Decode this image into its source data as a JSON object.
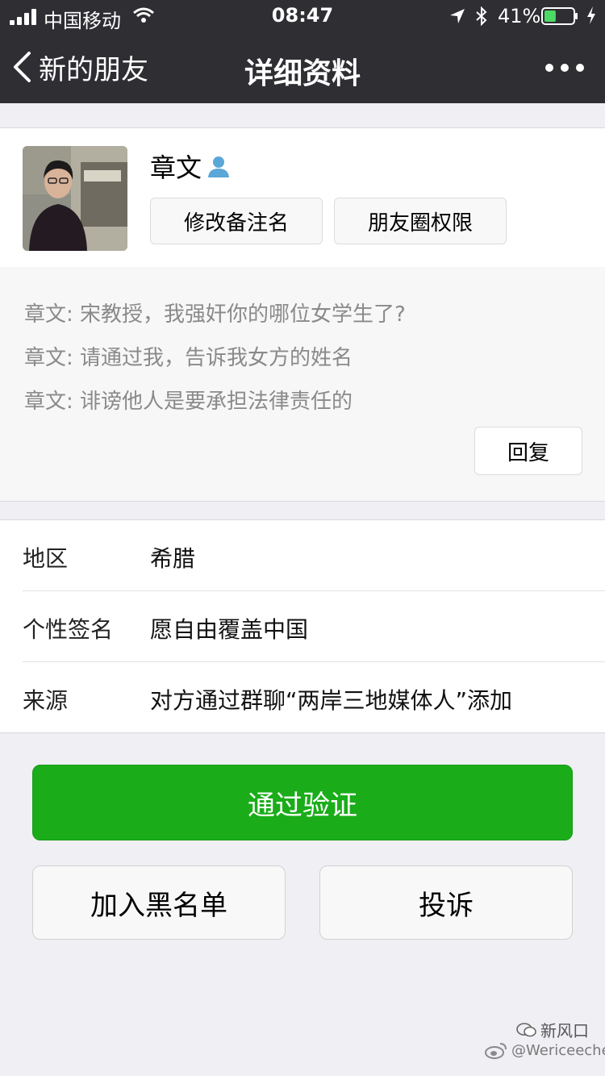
{
  "status_bar": {
    "carrier": "中国移动",
    "time": "08:47",
    "battery_percent": "41%",
    "battery_level": 0.41,
    "battery_color": "#4cd964"
  },
  "nav": {
    "back_label": "新的朋友",
    "title": "详细资料",
    "more_icon": "more-dots-icon"
  },
  "profile": {
    "name": "章文",
    "badge_icon": "person-icon",
    "remark_button": "修改备注名",
    "moments_button": "朋友圈权限"
  },
  "messages": [
    "章文: 宋教授，我强奸你的哪位女学生了?",
    "章文: 请通过我，告诉我女方的姓名",
    "章文: 诽谤他人是要承担法律责任的"
  ],
  "reply_button": "回复",
  "info": [
    {
      "label": "地区",
      "value": "希腊"
    },
    {
      "label": "个性签名",
      "value": "愿自由覆盖中国"
    },
    {
      "label": "来源",
      "value": "对方通过群聊“两岸三地媒体人”添加"
    }
  ],
  "actions": {
    "accept": "通过验证",
    "blacklist": "加入黑名单",
    "report": "投诉",
    "accept_color": "#1aad19"
  },
  "watermark": {
    "handle": "@Wericeechen",
    "logo_text": "新风口"
  }
}
